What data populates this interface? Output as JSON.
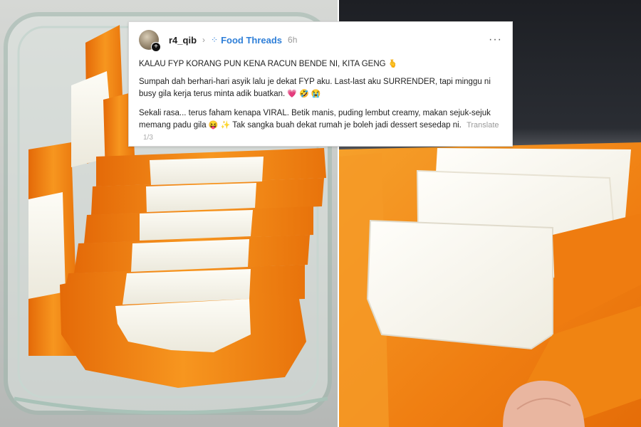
{
  "post": {
    "username": "r4_qib",
    "topic": "Food Threads",
    "time": "6h",
    "title": "KALAU FYP KORANG PUN KENA RACUN BENDE NI, KITA GENG",
    "title_emoji": "🫰",
    "para1": "Sumpah dah berhari-hari asyik lalu je dekat FYP aku. Last-last aku SURRENDER, tapi minggu ni busy gila kerja terus minta adik buatkan.",
    "para1_emojis": "💗 🤣 😭",
    "para2_part1": "Sekali rasa... terus faham kenapa VIRAL. Betik manis, puding lembut creamy, makan sejuk-sejuk memang padu gila",
    "para2_emojis": "😝 ✨",
    "para2_part2": "Tak sangka buah dekat rumah je boleh jadi dessert sesedap ni.",
    "translate": "Translate",
    "pager": "1/3"
  },
  "icons": {
    "avatar_plus": "+",
    "chevron": "›",
    "topic_icon": "⁘",
    "more": "···"
  },
  "colors": {
    "papaya": "#f07f12",
    "papaya_light": "#f8a22c",
    "pudding": "#fbfaf3",
    "link_blue": "#2f7fd8"
  }
}
